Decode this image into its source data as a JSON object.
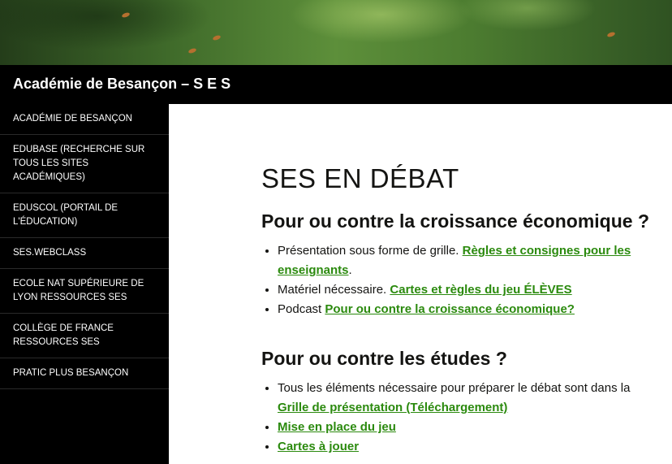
{
  "site": {
    "title": "Académie de Besançon – S E S"
  },
  "sidebar": {
    "items": [
      {
        "label": "ACADÉMIE DE BESANÇON"
      },
      {
        "label": "EDUBASE (RECHERCHE SUR TOUS LES SITES ACADÉMIQUES)"
      },
      {
        "label": "EDUSCOL (PORTAIL DE L'ÉDUCATION)"
      },
      {
        "label": "SES.WEBCLASS"
      },
      {
        "label": "ECOLE NAT SUPÉRIEURE DE LYON RESSOURCES SES"
      },
      {
        "label": "COLLÈGE DE FRANCE RESSOURCES SES"
      },
      {
        "label": "PRATIC PLUS BESANÇON"
      }
    ]
  },
  "main": {
    "page_title": "SES en débat",
    "sections": [
      {
        "heading": "Pour ou contre la croissance économique ?",
        "items": [
          {
            "text": "Présentation sous forme de grille. ",
            "link": "Règles et consignes pour les enseignants",
            "suffix": "."
          },
          {
            "text": "Matériel nécessaire. ",
            "link": "Cartes et règles du jeu ÉLÈVES",
            "suffix": ""
          },
          {
            "text": "Podcast ",
            "link": "Pour ou contre la croissance économique?",
            "suffix": ""
          }
        ]
      },
      {
        "heading": "Pour ou contre les études ?",
        "items": [
          {
            "text": "Tous les éléments nécessaire pour préparer le débat sont dans la ",
            "link": "Grille de présentation (Téléchargement)",
            "suffix": ""
          },
          {
            "text": "",
            "link": "Mise en place du jeu",
            "suffix": ""
          },
          {
            "text": "",
            "link": "Cartes à jouer",
            "suffix": ""
          }
        ]
      }
    ]
  }
}
